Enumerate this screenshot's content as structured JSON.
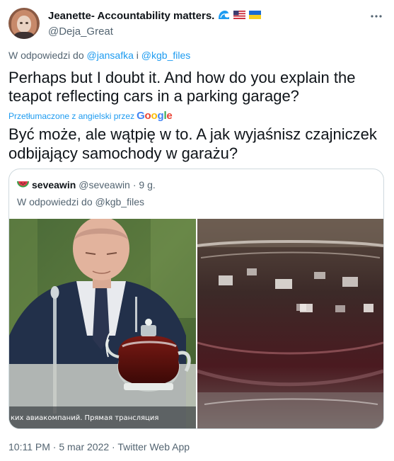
{
  "tweet": {
    "author": {
      "display_name": "Jeanette- Accountability matters.",
      "handle": "@Deja_Great",
      "badges": [
        "wave-icon",
        "us-flag-icon",
        "ukraine-flag-icon"
      ]
    },
    "reply_to": {
      "prefix": "W odpowiedzi do",
      "user1": "@jansafka",
      "separator": "i",
      "user2": "@kgb_files"
    },
    "text": "Perhaps but I doubt it. And how do you explain the teapot reflecting cars in a parking garage?",
    "translation_label": "Przetłumaczone z angielski przez",
    "translation_provider": "Google",
    "translated_text": "Być może, ale wątpię w to. A jak wyjaśnisz czajniczek odbijający samochody w garażu?",
    "footer": "10:11 PM · 5 mar 2022 · Twitter Web App"
  },
  "quoted_tweet": {
    "display_name": "seveawin",
    "handle": "@seveawin",
    "time": "· 9 g.",
    "avatar_icon": "watermelon-icon",
    "reply_prefix": "W odpowiedzi do",
    "reply_user": "@kgb_files",
    "media_caption": "ких авиакомпаний. Прямая трансляция"
  },
  "colors": {
    "link": "#1d9bf0",
    "secondary_text": "#536471",
    "border": "#cfd9de"
  }
}
